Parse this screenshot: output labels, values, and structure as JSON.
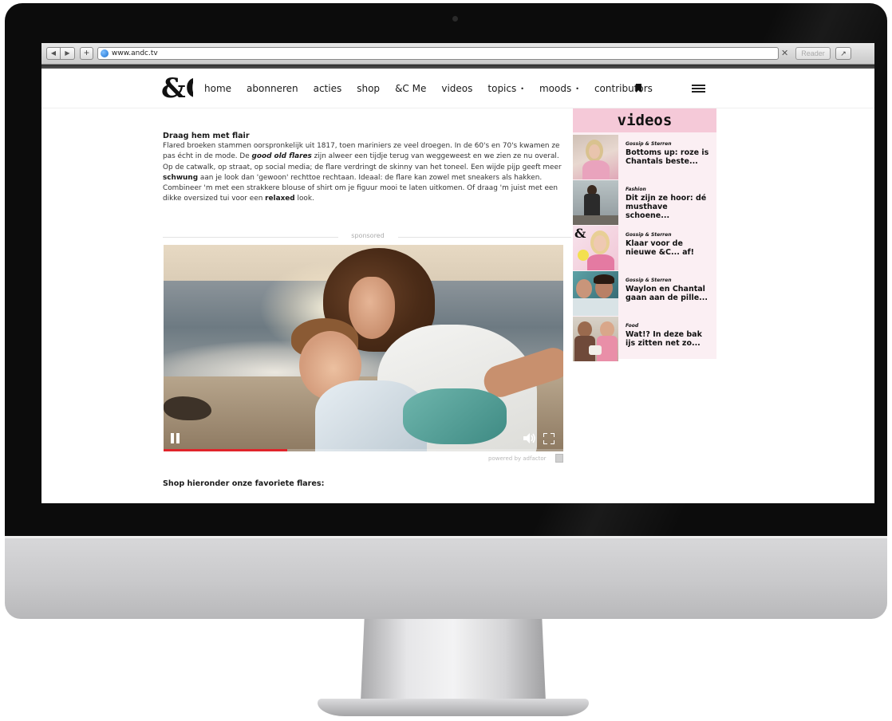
{
  "browser": {
    "url": "www.andc.tv",
    "reader_label": "Reader",
    "close_glyph": "✕",
    "back_glyph": "◀",
    "forward_glyph": "▶",
    "plus_glyph": "+",
    "share_glyph": "↗"
  },
  "nav": {
    "logo_text": "&C",
    "items": [
      {
        "label": "home"
      },
      {
        "label": "abonneren"
      },
      {
        "label": "acties"
      },
      {
        "label": "shop"
      },
      {
        "label": "&C Me"
      },
      {
        "label": "videos"
      },
      {
        "label": "topics",
        "has_dropdown": true
      },
      {
        "label": "moods",
        "has_dropdown": true
      },
      {
        "label": "contributors"
      }
    ],
    "dropdown_glyph": "•",
    "icons": [
      "bookmark-icon",
      "hamburger-icon"
    ]
  },
  "article": {
    "heading": "Draag hem met flair",
    "body_parts": {
      "p1": "Flared broeken stammen oorspronkelijk uit 1817, toen mariniers ze veel droegen. In de 60's en 70's kwamen ze pas écht in de mode. De ",
      "b1": "good old flares",
      "p2": " zijn alweer een tijdje terug van weggeweest en we zien ze nu overal. Op de catwalk, op straat, op social media; de flare verdringt de skinny van het toneel. Een wijde pijp geeft meer ",
      "b2": "schwung",
      "p3": " aan je look dan 'gewoon' rechttoe rechtaan. Ideaal: de flare kan zowel met sneakers als hakken. Combineer 'm met een strakkere blouse of shirt om je figuur mooi te laten uitkomen. Of draag 'm juist met een dikke oversized tui voor een ",
      "b3": "relaxed",
      "p4": " look."
    }
  },
  "sponsored_label": "sponsored",
  "video_player": {
    "progress": 0.31,
    "progress_color": "#e0242b",
    "powered_by": "powered by adfactor"
  },
  "shop_heading": "Shop hieronder onze favoriete flares:",
  "sidebar": {
    "title": "videos",
    "header_color": "#f5c9d8",
    "items": [
      {
        "category": "Gossip & Sterren",
        "title": "Bottoms up: roze is Chantals beste..."
      },
      {
        "category": "Fashion",
        "title": "Dit zijn ze hoor: dé musthave schoene..."
      },
      {
        "category": "Gossip & Sterren",
        "title": "Klaar voor de nieuwe &C... af!"
      },
      {
        "category": "Gossip & Sterren",
        "title": "Waylon en Chantal gaan aan de pille..."
      },
      {
        "category": "Food",
        "title": "Wat!? In deze bak ijs zitten net zo..."
      }
    ]
  }
}
